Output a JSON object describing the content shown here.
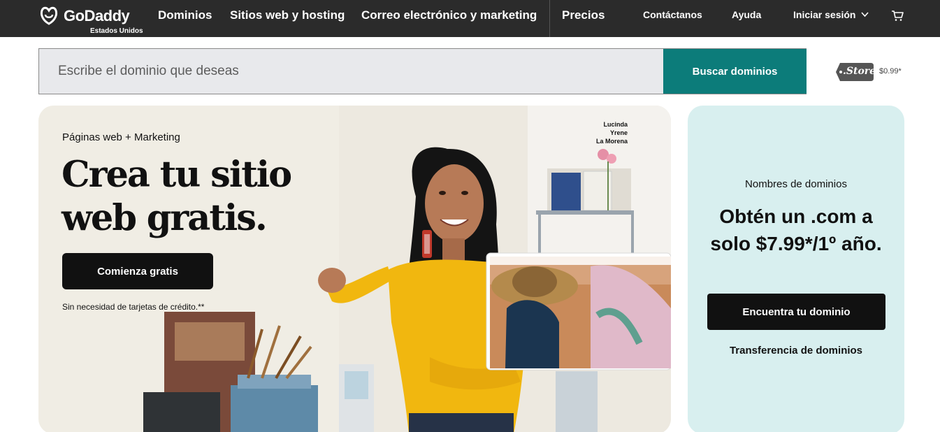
{
  "nav": {
    "brand": "GoDaddy",
    "region": "Estados Unidos",
    "links": [
      "Dominios",
      "Sitios web y hosting",
      "Correo electrónico y marketing",
      "Precios"
    ],
    "contact": "Contáctanos",
    "help": "Ayuda",
    "signin": "Iniciar sesión",
    "icons": [
      "godaddy-logo-icon",
      "chevron-down-icon",
      "cart-icon"
    ]
  },
  "search": {
    "placeholder": "Escribe el dominio que deseas",
    "button": "Buscar dominios",
    "promo_tld": ".Store",
    "promo_price": "$0.99*"
  },
  "hero": {
    "kicker": "Páginas web + Marketing",
    "title": "Crea tu sitio web gratis.",
    "cta": "Comienza gratis",
    "note": "Sin necesidad de tarjetas de crédito.**",
    "signature_line1": "Lucinda Yrene",
    "signature_line2": "La Morena"
  },
  "domain_card": {
    "kicker": "Nombres de dominios",
    "title": "Obtén un .com a solo $7.99*/1º año.",
    "cta": "Encuentra tu dominio",
    "link": "Transferencia de dominios"
  },
  "colors": {
    "nav_bg": "#2b2b2b",
    "search_button": "#0c7c7a",
    "hero_bg": "#f0ede4",
    "domain_card_bg": "#d8efef",
    "cta": "#111111"
  }
}
